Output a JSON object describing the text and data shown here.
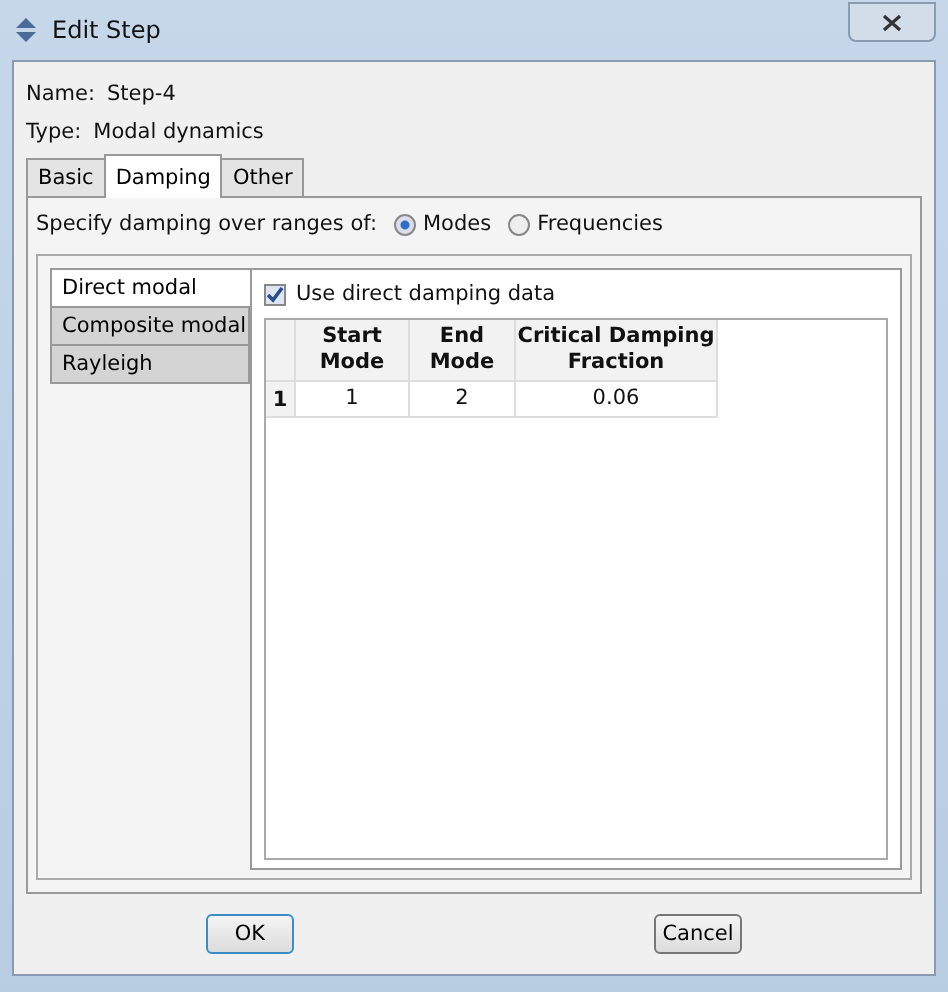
{
  "window": {
    "title": "Edit Step"
  },
  "name": {
    "label": "Name:",
    "value": "Step-4"
  },
  "type": {
    "label": "Type:",
    "value": "Modal dynamics"
  },
  "tabs": [
    {
      "label": "Basic",
      "selected": false
    },
    {
      "label": "Damping",
      "selected": true
    },
    {
      "label": "Other",
      "selected": false
    }
  ],
  "range": {
    "label": "Specify damping over ranges of:",
    "options": [
      {
        "label": "Modes",
        "selected": true
      },
      {
        "label": "Frequencies",
        "selected": false
      }
    ]
  },
  "damping_types": [
    {
      "label": "Direct modal",
      "selected": true
    },
    {
      "label": "Composite modal",
      "selected": false
    },
    {
      "label": "Rayleigh",
      "selected": false
    }
  ],
  "use_direct": {
    "label": "Use direct damping data",
    "checked": true
  },
  "table": {
    "columns": [
      "Start Mode",
      "End Mode",
      "Critical Damping Fraction"
    ],
    "rows": [
      {
        "number": "1",
        "cells": [
          "1",
          "2",
          "0.06"
        ]
      }
    ]
  },
  "buttons": [
    "OK",
    "Cancel"
  ]
}
